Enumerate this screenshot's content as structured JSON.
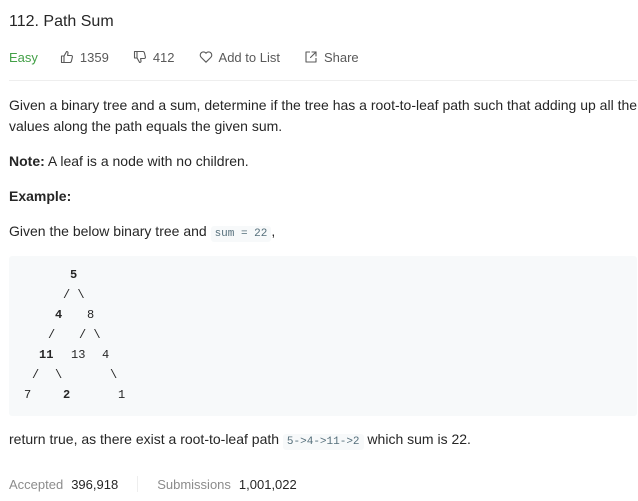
{
  "problem": {
    "title": "112. Path Sum",
    "difficulty": "Easy",
    "likes": "1359",
    "dislikes": "412",
    "add_to_list": "Add to List",
    "share": "Share"
  },
  "description": {
    "intro_line1": "Given a binary tree and a sum, determine if the tree has a root-to-leaf path such that adding up all the",
    "intro_line2": "values along the path equals the given sum.",
    "note_label": "Note:",
    "note_text": " A leaf is a node with no children.",
    "example_label": "Example:",
    "given_text": "Given the below binary tree and ",
    "given_code": "sum = 22",
    "given_suffix": ",",
    "tree": {
      "r1": "5",
      "r2": "/ \\",
      "r3a": "4",
      "r3b": "8",
      "r4a": "/",
      "r4b": "/ \\",
      "r5a": "11",
      "r5b": "13",
      "r5c": "4",
      "r6a": "/",
      "r6b": "\\",
      "r6c": "\\",
      "r7a": "7",
      "r7b": "2",
      "r7c": "1"
    },
    "result_text": "return true, as there exist a root-to-leaf path ",
    "result_code": "5->4->11->2",
    "result_suffix": " which sum is 22."
  },
  "stats": {
    "accepted_label": "Accepted",
    "accepted_value": "396,918",
    "submissions_label": "Submissions",
    "submissions_value": "1,001,022"
  },
  "colors": {
    "difficulty_easy": "#43a047",
    "code_bg": "#f7f9fa"
  }
}
